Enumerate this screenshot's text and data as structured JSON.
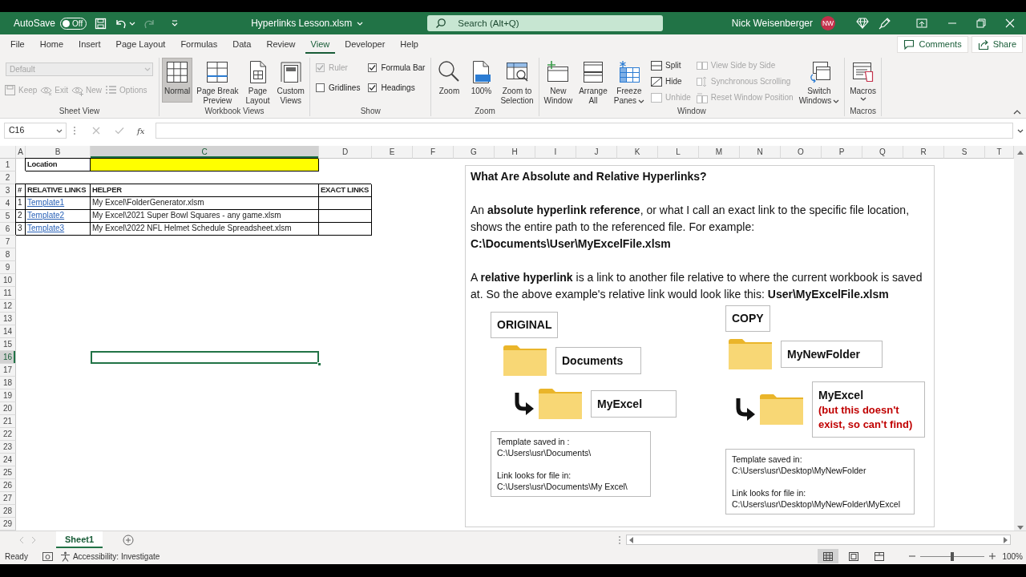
{
  "title_bar": {
    "autosave_label": "AutoSave",
    "autosave": {
      "on": false,
      "label": "Off"
    },
    "file_name": "Hyperlinks Lesson.xlsm",
    "search": {
      "placeholder": "Search (Alt+Q)"
    },
    "user_name": "Nick Weisenberger",
    "avatar_initials": "NW"
  },
  "tabs": [
    {
      "label": "File",
      "selected": false
    },
    {
      "label": "Home",
      "selected": false
    },
    {
      "label": "Insert",
      "selected": false
    },
    {
      "label": "Page Layout",
      "selected": false
    },
    {
      "label": "Formulas",
      "selected": false
    },
    {
      "label": "Data",
      "selected": false
    },
    {
      "label": "Review",
      "selected": false
    },
    {
      "label": "View",
      "selected": true
    },
    {
      "label": "Developer",
      "selected": false
    },
    {
      "label": "Help",
      "selected": false
    }
  ],
  "tab_buttons": [
    {
      "label": "Comments"
    },
    {
      "label": "Share"
    }
  ],
  "ribbon": {
    "groups": [
      {
        "kind": "sheet_view",
        "label": "Sheet View",
        "dropdown": {
          "value": "Default",
          "disabled": true
        },
        "buttons": [
          {
            "label": "Keep",
            "disabled": true
          },
          {
            "label": "Exit",
            "disabled": true
          },
          {
            "label": "New",
            "disabled": true
          },
          {
            "label": "Options",
            "disabled": true
          }
        ]
      },
      {
        "kind": "standard",
        "label": "Workbook Views",
        "columns": [
          [
            {
              "kind": "large",
              "label": "Normal",
              "selected": true
            }
          ],
          [
            {
              "kind": "large",
              "label": "Page Break Preview",
              "selected": false
            }
          ],
          [
            {
              "kind": "large",
              "label": "Page Layout",
              "selected": false
            }
          ],
          [
            {
              "kind": "large",
              "label": "Custom Views",
              "selected": false
            }
          ]
        ]
      },
      {
        "kind": "standard",
        "label": "Show",
        "columns": [
          [
            {
              "kind": "check",
              "label": "Ruler",
              "checked": true,
              "disabled": true
            },
            {
              "kind": "check",
              "label": "Gridlines",
              "checked": false,
              "disabled": false
            }
          ],
          [
            {
              "kind": "check",
              "label": "Formula Bar",
              "checked": true,
              "disabled": false
            },
            {
              "kind": "check",
              "label": "Headings",
              "checked": true,
              "disabled": false
            }
          ]
        ]
      },
      {
        "kind": "standard",
        "label": "Zoom",
        "columns": [
          [
            {
              "kind": "large",
              "label": "Zoom"
            }
          ],
          [
            {
              "kind": "large",
              "label": "100%"
            }
          ],
          [
            {
              "kind": "large",
              "label": "Zoom to Selection"
            }
          ]
        ]
      },
      {
        "kind": "standard",
        "label": "Window",
        "columns": [
          [
            {
              "kind": "large",
              "label": "New Window"
            }
          ],
          [
            {
              "kind": "large",
              "label": "Arrange All"
            }
          ],
          [
            {
              "kind": "large",
              "label": "Freeze Panes",
              "dropdown": true
            }
          ],
          [
            {
              "kind": "small",
              "label": "Split",
              "disabled": false
            },
            {
              "kind": "small",
              "label": "Hide",
              "disabled": false
            },
            {
              "kind": "small",
              "label": "Unhide",
              "disabled": true
            }
          ],
          [
            {
              "kind": "small",
              "label": "View Side by Side",
              "disabled": true
            },
            {
              "kind": "small",
              "label": "Synchronous Scrolling",
              "disabled": true
            },
            {
              "kind": "small",
              "label": "Reset Window Position",
              "disabled": true
            }
          ],
          [
            {
              "kind": "large",
              "label": "Switch Windows",
              "dropdown": true
            }
          ]
        ]
      },
      {
        "kind": "standard",
        "label": "Macros",
        "columns": [
          [
            {
              "kind": "large",
              "label": "Macros",
              "dropdown": true
            }
          ]
        ]
      }
    ]
  },
  "formula_bar": {
    "name_box": "C16",
    "function_label": "fx"
  },
  "sheet": {
    "columns": [
      "A",
      "B",
      "C",
      "D",
      "E",
      "F",
      "G",
      "H",
      "I",
      "J",
      "K",
      "L",
      "M",
      "N",
      "O",
      "P",
      "Q",
      "R",
      "S",
      "T"
    ],
    "rows": [
      {
        "number": "1",
        "cells": [
          {
            "kind": "empty",
            "selected": false
          },
          {
            "kind": "text",
            "text": "Location",
            "bold": true,
            "bordered": true,
            "selected": false
          },
          {
            "kind": "empty",
            "highlighted": true,
            "bordered": true,
            "selected": false
          }
        ]
      },
      {
        "number": "2"
      },
      {
        "number": "3",
        "cells": [
          {
            "kind": "text",
            "text": "#",
            "bold": true,
            "bordered": true,
            "selected": false
          },
          {
            "kind": "text",
            "text": "RELATIVE LINKS",
            "bold": true,
            "bordered": true,
            "selected": false
          },
          {
            "kind": "text",
            "text": "HELPER",
            "bold": true,
            "bordered": true,
            "selected": false
          },
          {
            "kind": "text",
            "text": "EXACT LINKS",
            "bold": true,
            "bordered": true,
            "selected": false
          }
        ]
      },
      {
        "number": "4",
        "cells": [
          {
            "kind": "text",
            "text": "1",
            "bordered": true,
            "selected": false
          },
          {
            "kind": "link",
            "text": "Template1",
            "bordered": true,
            "selected": false
          },
          {
            "kind": "text",
            "text": "My Excel\\FolderGenerator.xlsm",
            "bordered": true,
            "selected": false
          },
          {
            "kind": "empty",
            "bordered": true,
            "selected": false
          }
        ]
      },
      {
        "number": "5",
        "cells": [
          {
            "kind": "text",
            "text": "2",
            "bordered": true,
            "selected": false
          },
          {
            "kind": "link",
            "text": "Template2",
            "bordered": true,
            "selected": false
          },
          {
            "kind": "text",
            "text": "My Excel\\2021 Super Bowl Squares - any game.xlsm",
            "bordered": true,
            "selected": false
          },
          {
            "kind": "empty",
            "bordered": true,
            "selected": false
          }
        ]
      },
      {
        "number": "6",
        "cells": [
          {
            "kind": "text",
            "text": "3",
            "bordered": true,
            "selected": false
          },
          {
            "kind": "link",
            "text": "Template3",
            "bordered": true,
            "selected": false
          },
          {
            "kind": "text",
            "text": "My Excel\\2022 NFL Helmet Schedule Spreadsheet.xlsm",
            "bordered": true,
            "selected": false
          },
          {
            "kind": "empty",
            "bordered": true,
            "selected": false
          }
        ]
      },
      {
        "number": "7"
      },
      {
        "number": "8"
      },
      {
        "number": "9"
      },
      {
        "number": "10"
      },
      {
        "number": "11"
      },
      {
        "number": "12"
      },
      {
        "number": "13"
      },
      {
        "number": "14"
      },
      {
        "number": "15"
      },
      {
        "number": "16",
        "cells": [
          {
            "kind": "empty",
            "selected": false
          },
          {
            "kind": "empty",
            "selected": false
          },
          {
            "kind": "empty",
            "selected": true
          }
        ]
      },
      {
        "number": "17"
      },
      {
        "number": "18"
      },
      {
        "number": "19"
      },
      {
        "number": "20"
      },
      {
        "number": "21"
      },
      {
        "number": "22"
      },
      {
        "number": "23"
      },
      {
        "number": "24"
      },
      {
        "number": "25"
      },
      {
        "number": "26"
      },
      {
        "number": "27"
      },
      {
        "number": "28"
      },
      {
        "number": "29"
      }
    ]
  },
  "text_shape": {
    "title": "What Are Absolute and Relative Hyperlinks?",
    "paragraphs": [
      "An **absolute hyperlink reference**, or what I call an exact link to the specific file location, shows the entire path to the referenced file. For example: **C:\\Documents\\User\\MyExcelFile.xlsm**",
      "A **relative hyperlink** is a link to another file relative to where the current workbook is saved at. So the above example's relative link would look like this: **User\\MyExcelFile.xlsm**"
    ],
    "panels": [
      {
        "label": "ORIGINAL",
        "folders": [
          {
            "name": "Documents"
          },
          {
            "name": "MyExcel"
          }
        ],
        "notes": [
          {
            "heading": "Template saved in :",
            "path": "C:\\Users\\usr\\Documents\\"
          },
          {
            "heading": "Link looks for file in:",
            "path": "C:\\Users\\usr\\Documents\\My Excel\\"
          }
        ]
      },
      {
        "label": "COPY",
        "folders": [
          {
            "name": "MyNewFolder"
          },
          {
            "name": "MyExcel",
            "remark": "(but this doesn't exist, so can't find)"
          }
        ],
        "notes": [
          {
            "heading": "Template saved in:",
            "path": "C:\\Users\\usr\\Desktop\\MyNewFolder"
          },
          {
            "heading": "Link looks for file in:",
            "path": "C:\\Users\\usr\\Desktop\\MyNewFolder\\MyExcel"
          }
        ]
      }
    ]
  },
  "sheet_tabs": [
    {
      "label": "Sheet1",
      "selected": true
    }
  ],
  "status_bar": {
    "status": "Ready",
    "accessibility": "Accessibility: Investigate",
    "view_buttons": [
      {
        "selected": true
      },
      {
        "selected": false
      },
      {
        "selected": false
      }
    ],
    "zoom": {
      "level": 0.5,
      "label": "100%"
    }
  }
}
